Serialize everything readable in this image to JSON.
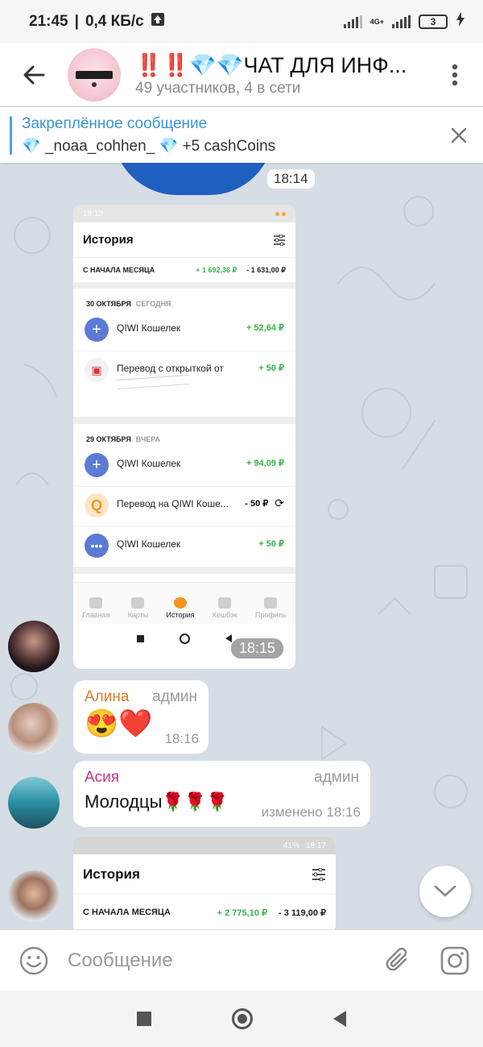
{
  "status": {
    "time": "21:45",
    "speed": "0,4 КБ/с",
    "network": "4G+",
    "battery": "3"
  },
  "header": {
    "title_marks": "‼️‼️",
    "title_gems": "💎💎",
    "title_text": "ЧАТ ДЛЯ ИНФ...",
    "subtitle": "49 участников, 4 в сети",
    "icons": {
      "back": "arrow-left-icon",
      "menu": "more-vertical-icon"
    }
  },
  "pinned": {
    "title": "Закреплённое сообщение",
    "gem": "💎",
    "user": "_noaa_cohhen_",
    "text": "+5 cashCoins"
  },
  "messages": {
    "sticker_time": "18:14",
    "photo1": {
      "time": "18:15",
      "status_time": "18:13",
      "title": "История",
      "month_label": "С НАЧАЛА МЕСЯЦА",
      "month_in": "+ 1 692,36 ₽",
      "month_out": "- 1 631,00 ₽",
      "day1": {
        "date": "30 ОКТЯБРЯ",
        "rel": "СЕГОДНЯ"
      },
      "items1": [
        {
          "name": "QIWI Кошелек",
          "amount": "+ 52,64 ₽"
        },
        {
          "name": "Перевод с открыткой от",
          "amount": "+ 50 ₽"
        }
      ],
      "day2": {
        "date": "29 ОКТЯБРЯ",
        "rel": "ВЧЕРА"
      },
      "items2": [
        {
          "name": "QIWI Кошелек",
          "amount": "+ 94,09 ₽"
        },
        {
          "name": "Перевод на QIWI Коше...",
          "amount": "- 50 ₽"
        },
        {
          "name": "QIWI Кошелек",
          "amount": "+ 50 ₽"
        }
      ],
      "nav": [
        "Главная",
        "Карты",
        "История",
        "Кешбэк",
        "Профиль"
      ]
    },
    "msg_alina": {
      "name": "Алина",
      "role": "админ",
      "text": "😍❤️",
      "time": "18:16"
    },
    "msg_asia": {
      "name": "Асия",
      "role": "админ",
      "text": "Молодцы🌹🌹🌹",
      "time": "изменено 18:16"
    },
    "photo2": {
      "status_right": "41%",
      "status_time": "18:17",
      "title": "История",
      "month_label": "С НАЧАЛА МЕСЯЦА",
      "month_in": "+ 2 775,10 ₽",
      "month_out": "- 3 119,00 ₽"
    }
  },
  "input": {
    "placeholder": "Сообщение"
  },
  "colors": {
    "accent": "#3a95d2",
    "alina": "#e07b2a",
    "asia": "#c4377a",
    "green": "#39b44a"
  }
}
